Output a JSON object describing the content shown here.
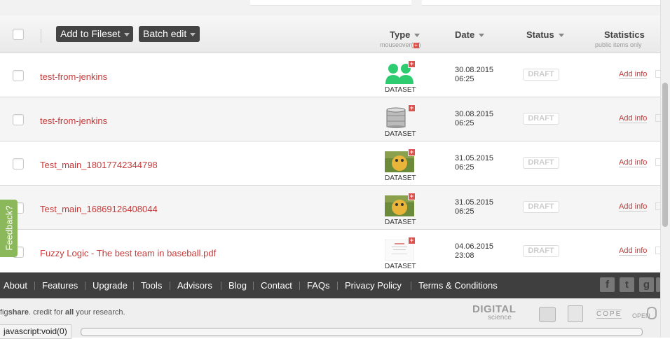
{
  "toolbar": {
    "add_to_fileset": "Add to Fileset",
    "batch_edit": "Batch edit"
  },
  "columns": {
    "type": "Type",
    "type_sub": "mouseover(",
    "type_sub_end": ")",
    "date": "Date",
    "status": "Status",
    "statistics": "Statistics",
    "statistics_sub": "public items only"
  },
  "rows": [
    {
      "title": "test-from-jenkins",
      "type": "DATASET",
      "thumb": "people-icon",
      "date": "30.08.2015",
      "time": "06:25",
      "status": "DRAFT",
      "action": "Add info"
    },
    {
      "title": "test-from-jenkins",
      "type": "DATASET",
      "thumb": "database-icon",
      "date": "30.08.2015",
      "time": "06:25",
      "status": "DRAFT",
      "action": "Add info"
    },
    {
      "title": "Test_main_18017742344798",
      "type": "DATASET",
      "thumb": "image-thumbnail",
      "date": "31.05.2015",
      "time": "06:25",
      "status": "DRAFT",
      "action": "Add info"
    },
    {
      "title": "Test_main_16869126408044",
      "type": "DATASET",
      "thumb": "image-thumbnail",
      "date": "31.05.2015",
      "time": "06:25",
      "status": "DRAFT",
      "action": "Add info"
    },
    {
      "title": "Fuzzy Logic - The best team in baseball.pdf",
      "type": "DATASET",
      "thumb": "document-thumbnail",
      "date": "04.06.2015",
      "time": "23:08",
      "status": "DRAFT",
      "action": "Add info"
    }
  ],
  "footer": {
    "links": [
      "About",
      "Features",
      "Upgrade",
      "Tools",
      "Advisors",
      "Blog",
      "Contact",
      "FAQs",
      "Privacy Policy",
      "Terms & Conditions"
    ],
    "social": [
      "f",
      "t",
      "g"
    ],
    "credit_prefix": "fig",
    "credit_brand": "share",
    "credit_mid": ". credit for ",
    "credit_bold": "all",
    "credit_end": " your research.",
    "partner_digital": "DIGITAL",
    "partner_science": "science",
    "partner_cope": "COPE",
    "partner_open": "OPEN"
  },
  "feedback": "Feedback?",
  "status_bar": "javascript:void(0)",
  "colors": {
    "accent": "#c63b3b",
    "dark": "#3f3f3f",
    "feedback": "#8cb85c",
    "plus": "#d9534f"
  }
}
